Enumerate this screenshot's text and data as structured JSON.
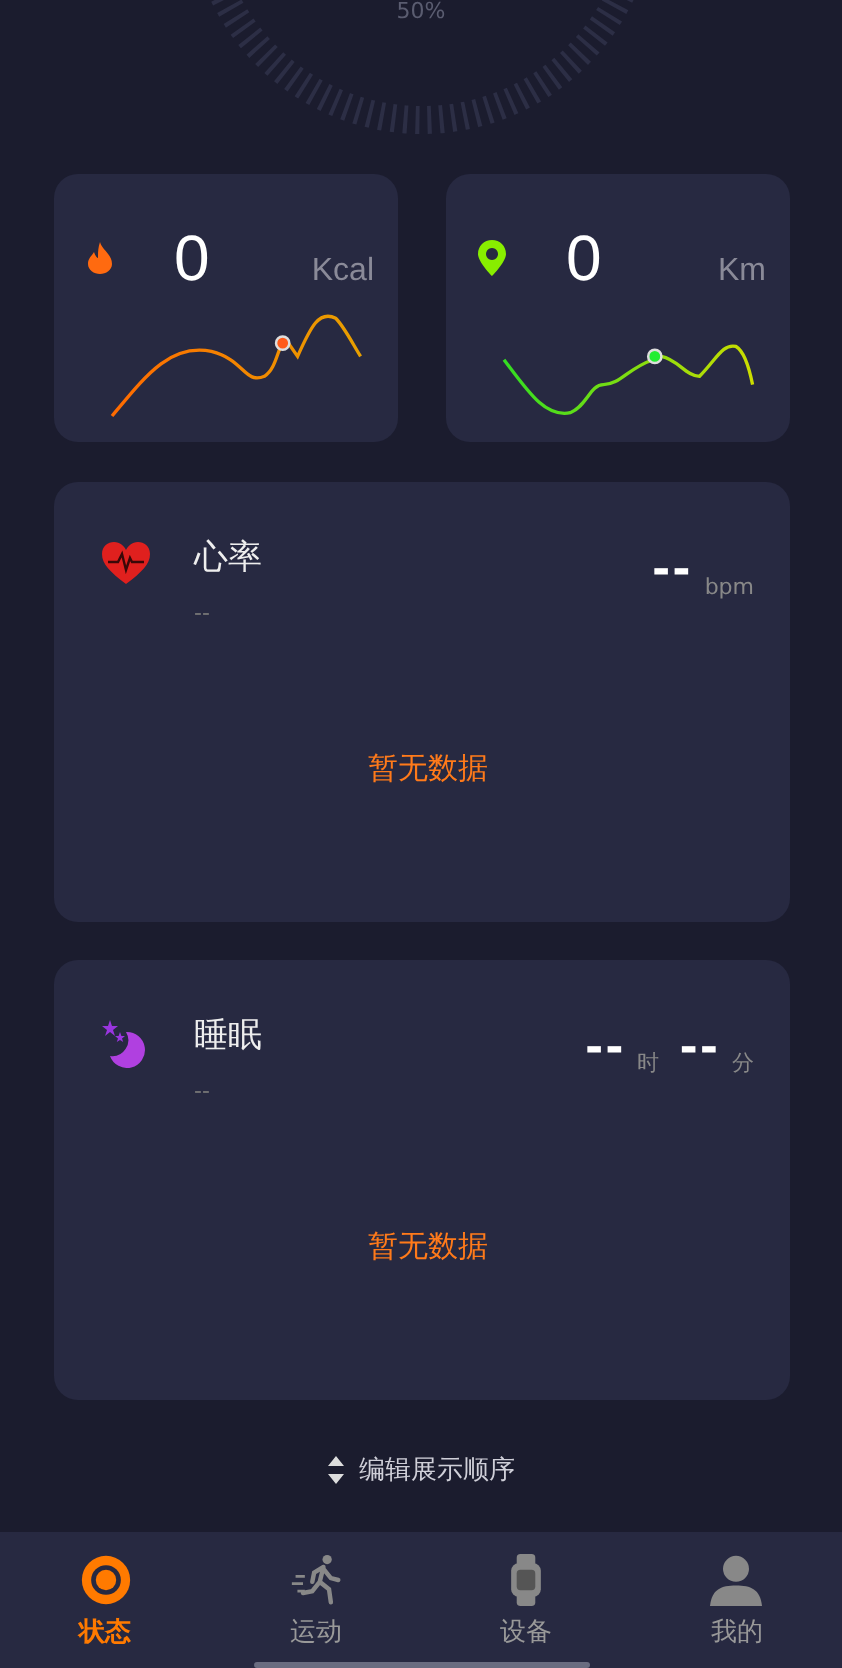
{
  "ring": {
    "percent": "50%"
  },
  "stats": [
    {
      "kind": "calories",
      "value": "0",
      "unit": "Kcal"
    },
    {
      "kind": "distance",
      "value": "0",
      "unit": "Km"
    }
  ],
  "metrics": [
    {
      "kind": "heart",
      "title": "心率",
      "sub": "--",
      "readings": [
        {
          "value": "--",
          "unit": "bpm"
        }
      ],
      "empty": "暂无数据"
    },
    {
      "kind": "sleep",
      "title": "睡眠",
      "sub": "--",
      "readings": [
        {
          "value": "--",
          "unit": "时"
        },
        {
          "value": "--",
          "unit": "分"
        }
      ],
      "empty": "暂无数据"
    }
  ],
  "edit_order": "编辑展示顺序",
  "tabs": [
    {
      "kind": "status",
      "label": "状态",
      "selected": true
    },
    {
      "kind": "sport",
      "label": "运动",
      "selected": false
    },
    {
      "kind": "device",
      "label": "设备",
      "selected": false
    },
    {
      "kind": "me",
      "label": "我的",
      "selected": false
    }
  ]
}
